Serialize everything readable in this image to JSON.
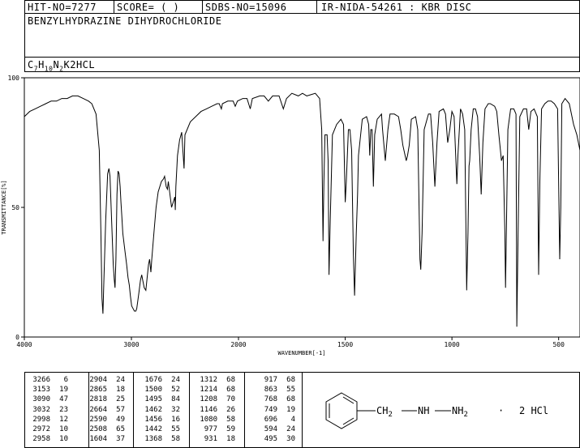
{
  "header": {
    "hit_no": "HIT-NO=7277",
    "score": "SCORE=  (   )",
    "sdbs_no": "SDBS-NO=15096",
    "ir_info": "IR-NIDA-54261 : KBR DISC",
    "compound_name": "BENZYLHYDRAZINE DIHYDROCHLORIDE",
    "formula": {
      "c": "C",
      "c_sub": "7",
      "h": "H",
      "h_sub": "10",
      "n": "N",
      "n_sub": "2",
      "suffix": "K2HCL"
    }
  },
  "chart_data": {
    "type": "line",
    "xlabel": "WAVENUMBER[-1]",
    "ylabel": "TRANSMITTANCE[%]",
    "xlim": [
      4000,
      400
    ],
    "ylim": [
      0,
      100
    ],
    "x_ticks": [
      4000,
      3000,
      2000,
      1500,
      1000,
      500
    ],
    "y_ticks": [
      0,
      50,
      100
    ],
    "x_tick_labels": [
      "4000",
      "3000",
      "2000",
      "1500",
      "1000",
      "500"
    ],
    "y_tick_labels": [
      "0",
      "50",
      "100"
    ],
    "series": [
      {
        "points": [
          [
            4000,
            85
          ],
          [
            3950,
            87
          ],
          [
            3900,
            88
          ],
          [
            3850,
            89
          ],
          [
            3800,
            90
          ],
          [
            3750,
            91
          ],
          [
            3700,
            91
          ],
          [
            3650,
            92
          ],
          [
            3600,
            92
          ],
          [
            3550,
            93
          ],
          [
            3500,
            93
          ],
          [
            3450,
            92
          ],
          [
            3400,
            91
          ],
          [
            3370,
            90
          ],
          [
            3330,
            86
          ],
          [
            3300,
            72
          ],
          [
            3285,
            40
          ],
          [
            3275,
            15
          ],
          [
            3266,
            9
          ],
          [
            3258,
            20
          ],
          [
            3240,
            45
          ],
          [
            3222,
            63
          ],
          [
            3210,
            65
          ],
          [
            3200,
            62
          ],
          [
            3185,
            45
          ],
          [
            3170,
            28
          ],
          [
            3160,
            22
          ],
          [
            3153,
            19
          ],
          [
            3145,
            30
          ],
          [
            3135,
            55
          ],
          [
            3125,
            64
          ],
          [
            3115,
            63
          ],
          [
            3105,
            58
          ],
          [
            3098,
            52
          ],
          [
            3090,
            47
          ],
          [
            3080,
            40
          ],
          [
            3060,
            33
          ],
          [
            3045,
            28
          ],
          [
            3032,
            23
          ],
          [
            3020,
            20
          ],
          [
            3010,
            16
          ],
          [
            2998,
            12
          ],
          [
            2985,
            11
          ],
          [
            2972,
            10
          ],
          [
            2965,
            10
          ],
          [
            2958,
            10
          ],
          [
            2950,
            11
          ],
          [
            2930,
            17
          ],
          [
            2915,
            22
          ],
          [
            2904,
            24
          ],
          [
            2895,
            22
          ],
          [
            2880,
            19
          ],
          [
            2865,
            18
          ],
          [
            2855,
            22
          ],
          [
            2840,
            28
          ],
          [
            2830,
            30
          ],
          [
            2818,
            25
          ],
          [
            2810,
            30
          ],
          [
            2790,
            40
          ],
          [
            2770,
            50
          ],
          [
            2750,
            56
          ],
          [
            2720,
            60
          ],
          [
            2700,
            61
          ],
          [
            2690,
            62
          ],
          [
            2675,
            58
          ],
          [
            2664,
            57
          ],
          [
            2655,
            60
          ],
          [
            2640,
            55
          ],
          [
            2625,
            50
          ],
          [
            2610,
            52
          ],
          [
            2595,
            54
          ],
          [
            2590,
            49
          ],
          [
            2585,
            58
          ],
          [
            2570,
            70
          ],
          [
            2550,
            76
          ],
          [
            2530,
            79
          ],
          [
            2508,
            65
          ],
          [
            2500,
            78
          ],
          [
            2450,
            83
          ],
          [
            2400,
            85
          ],
          [
            2350,
            87
          ],
          [
            2300,
            88
          ],
          [
            2250,
            89
          ],
          [
            2200,
            90
          ],
          [
            2180,
            90
          ],
          [
            2160,
            88
          ],
          [
            2150,
            90
          ],
          [
            2100,
            91
          ],
          [
            2050,
            91
          ],
          [
            2030,
            89
          ],
          [
            2010,
            91
          ],
          [
            1980,
            92
          ],
          [
            1960,
            92
          ],
          [
            1945,
            88
          ],
          [
            1935,
            92
          ],
          [
            1900,
            93
          ],
          [
            1880,
            93
          ],
          [
            1860,
            91
          ],
          [
            1840,
            93
          ],
          [
            1810,
            93
          ],
          [
            1790,
            88
          ],
          [
            1775,
            92
          ],
          [
            1750,
            94
          ],
          [
            1720,
            93
          ],
          [
            1700,
            94
          ],
          [
            1680,
            93
          ],
          [
            1640,
            94
          ],
          [
            1620,
            92
          ],
          [
            1610,
            80
          ],
          [
            1604,
            37
          ],
          [
            1600,
            60
          ],
          [
            1595,
            78
          ],
          [
            1585,
            78
          ],
          [
            1580,
            68
          ],
          [
            1576,
            24
          ],
          [
            1570,
            45
          ],
          [
            1560,
            78
          ],
          [
            1540,
            82
          ],
          [
            1520,
            84
          ],
          [
            1508,
            82
          ],
          [
            1500,
            52
          ],
          [
            1495,
            60
          ],
          [
            1490,
            70
          ],
          [
            1485,
            80
          ],
          [
            1478,
            80
          ],
          [
            1470,
            72
          ],
          [
            1462,
            32
          ],
          [
            1456,
            16
          ],
          [
            1448,
            40
          ],
          [
            1442,
            55
          ],
          [
            1438,
            70
          ],
          [
            1420,
            84
          ],
          [
            1400,
            85
          ],
          [
            1390,
            82
          ],
          [
            1385,
            70
          ],
          [
            1380,
            80
          ],
          [
            1374,
            80
          ],
          [
            1368,
            58
          ],
          [
            1362,
            78
          ],
          [
            1350,
            84
          ],
          [
            1330,
            86
          ],
          [
            1325,
            80
          ],
          [
            1312,
            68
          ],
          [
            1300,
            80
          ],
          [
            1290,
            86
          ],
          [
            1270,
            86
          ],
          [
            1250,
            85
          ],
          [
            1240,
            80
          ],
          [
            1230,
            74
          ],
          [
            1214,
            68
          ],
          [
            1208,
            70
          ],
          [
            1200,
            74
          ],
          [
            1190,
            84
          ],
          [
            1170,
            85
          ],
          [
            1160,
            80
          ],
          [
            1150,
            30
          ],
          [
            1146,
            26
          ],
          [
            1140,
            40
          ],
          [
            1130,
            80
          ],
          [
            1110,
            86
          ],
          [
            1100,
            86
          ],
          [
            1090,
            75
          ],
          [
            1080,
            58
          ],
          [
            1070,
            75
          ],
          [
            1060,
            87
          ],
          [
            1040,
            88
          ],
          [
            1030,
            86
          ],
          [
            1020,
            75
          ],
          [
            1010,
            80
          ],
          [
            1000,
            87
          ],
          [
            990,
            85
          ],
          [
            980,
            65
          ],
          [
            977,
            59
          ],
          [
            972,
            70
          ],
          [
            960,
            88
          ],
          [
            950,
            86
          ],
          [
            940,
            80
          ],
          [
            931,
            18
          ],
          [
            925,
            40
          ],
          [
            920,
            66
          ],
          [
            917,
            68
          ],
          [
            910,
            80
          ],
          [
            900,
            88
          ],
          [
            890,
            88
          ],
          [
            880,
            85
          ],
          [
            870,
            70
          ],
          [
            863,
            55
          ],
          [
            855,
            75
          ],
          [
            845,
            88
          ],
          [
            830,
            90
          ],
          [
            820,
            90
          ],
          [
            800,
            89
          ],
          [
            790,
            87
          ],
          [
            780,
            78
          ],
          [
            768,
            68
          ],
          [
            760,
            70
          ],
          [
            752,
            40
          ],
          [
            749,
            19
          ],
          [
            745,
            40
          ],
          [
            738,
            80
          ],
          [
            725,
            88
          ],
          [
            710,
            88
          ],
          [
            700,
            86
          ],
          [
            696,
            4
          ],
          [
            690,
            40
          ],
          [
            682,
            85
          ],
          [
            665,
            88
          ],
          [
            650,
            88
          ],
          [
            640,
            80
          ],
          [
            630,
            87
          ],
          [
            615,
            88
          ],
          [
            600,
            85
          ],
          [
            594,
            24
          ],
          [
            588,
            60
          ],
          [
            580,
            88
          ],
          [
            565,
            90
          ],
          [
            550,
            91
          ],
          [
            535,
            91
          ],
          [
            520,
            90
          ],
          [
            505,
            88
          ],
          [
            495,
            30
          ],
          [
            490,
            50
          ],
          [
            485,
            90
          ],
          [
            470,
            92
          ],
          [
            450,
            90
          ],
          [
            430,
            82
          ],
          [
            415,
            78
          ],
          [
            400,
            72
          ]
        ]
      }
    ]
  },
  "peak_table": {
    "columns": [
      [
        [
          "3266",
          "6"
        ],
        [
          "3153",
          "19"
        ],
        [
          "3090",
          "47"
        ],
        [
          "3032",
          "23"
        ],
        [
          "2998",
          "12"
        ],
        [
          "2972",
          "10"
        ],
        [
          "2958",
          "10"
        ]
      ],
      [
        [
          "2904",
          "24"
        ],
        [
          "2865",
          "18"
        ],
        [
          "2818",
          "25"
        ],
        [
          "2664",
          "57"
        ],
        [
          "2590",
          "49"
        ],
        [
          "2508",
          "65"
        ],
        [
          "1604",
          "37"
        ]
      ],
      [
        [
          "1676",
          "24"
        ],
        [
          "1500",
          "52"
        ],
        [
          "1495",
          "84"
        ],
        [
          "1462",
          "32"
        ],
        [
          "1456",
          "16"
        ],
        [
          "1442",
          "55"
        ],
        [
          "1368",
          "58"
        ]
      ],
      [
        [
          "1312",
          "68"
        ],
        [
          "1214",
          "68"
        ],
        [
          "1208",
          "70"
        ],
        [
          "1146",
          "26"
        ],
        [
          "1080",
          "58"
        ],
        [
          "977",
          "59"
        ],
        [
          "931",
          "18"
        ]
      ],
      [
        [
          "917",
          "68"
        ],
        [
          "863",
          "55"
        ],
        [
          "768",
          "68"
        ],
        [
          "749",
          "19"
        ],
        [
          "696",
          "4"
        ],
        [
          "594",
          "24"
        ],
        [
          "495",
          "30"
        ]
      ]
    ]
  },
  "structure": {
    "ch2": "CH",
    "ch2_sub": "2",
    "nh": "NH",
    "nh2": "NH",
    "nh2_sub": "2",
    "dot": "·",
    "salt": "2 HCl"
  }
}
